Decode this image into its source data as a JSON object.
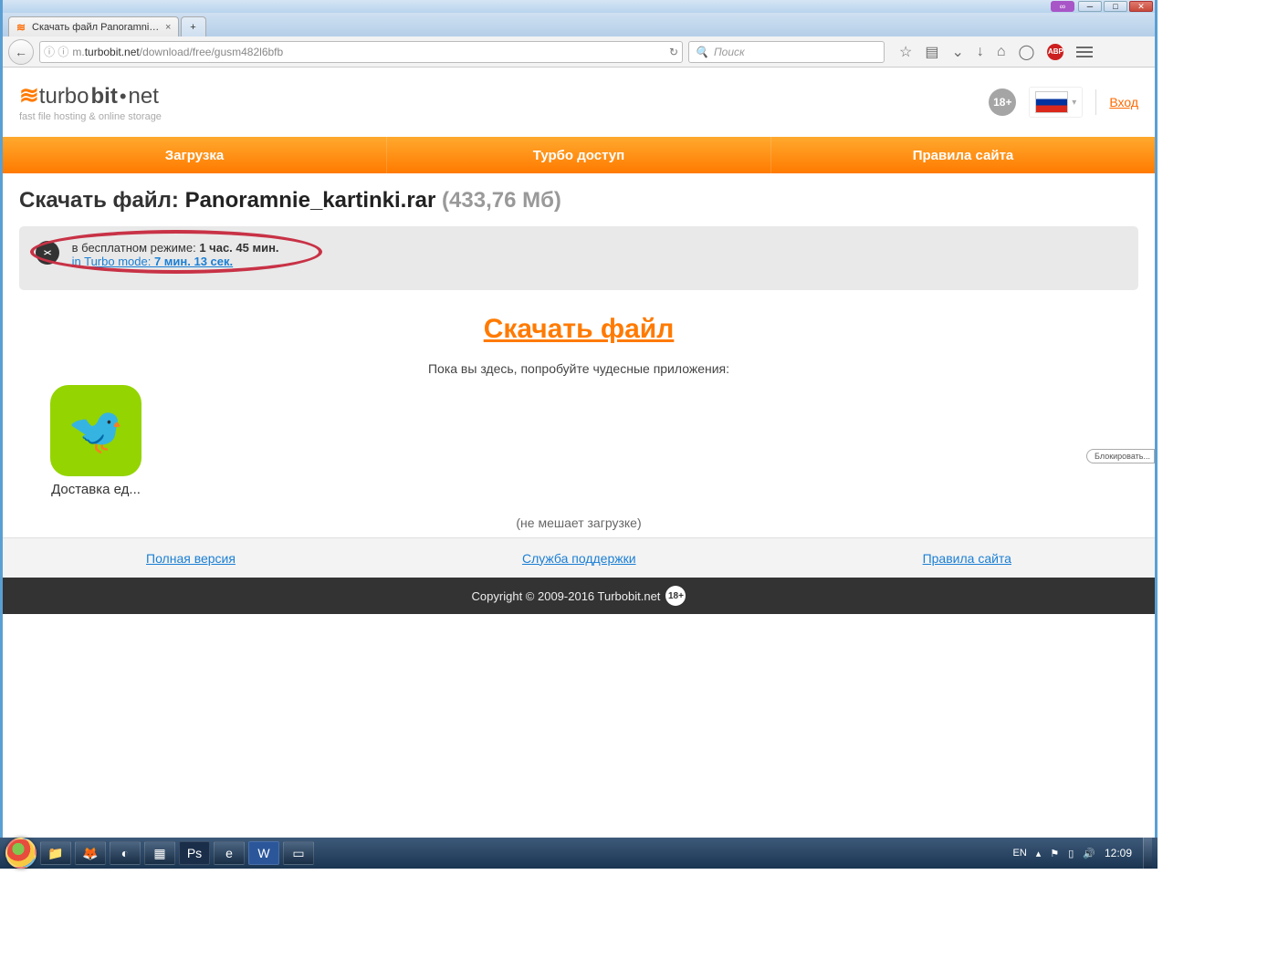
{
  "window": {
    "tab_title": "Скачать файл Panoramnie...",
    "new_tab": "+"
  },
  "url": {
    "prefix": "m.",
    "host": "turbobit.net",
    "path": "/download/free/gusm482l6bfb"
  },
  "search_placeholder": "Поиск",
  "site": {
    "logo_word": "turbo",
    "logo_bold": "bit",
    "logo_tld": "net",
    "tagline": "fast file hosting & online storage",
    "age_badge": "18+",
    "login": "Вход"
  },
  "menu": [
    "Загрузка",
    "Турбо доступ",
    "Правила сайта"
  ],
  "download": {
    "title_prefix": "Скачать файл: ",
    "filename": "Panoramnie_kartinki.rar",
    "filesize": "(433,76 Мб)",
    "free_label": "в бесплатном режиме: ",
    "free_time": "1 час. 45 мин.",
    "turbo_label": "in Turbo mode: ",
    "turbo_time": "7 мин. 13 сек.",
    "big_link": "Скачать файл",
    "apps_intro": "Пока вы здесь, попробуйте чудесные приложения:",
    "block_label": "Блокировать...",
    "app_name": "Доставка ед...",
    "no_interfere": "(не мешает загрузке)"
  },
  "footer": {
    "links": [
      "Полная версия",
      "Служба поддержки",
      "Правила сайта"
    ],
    "copyright": "Copyright © 2009-2016 Turbobit.net",
    "age": "18+"
  },
  "taskbar": {
    "lang": "EN",
    "time": "12:09"
  },
  "toolbar_abp": "ABP"
}
